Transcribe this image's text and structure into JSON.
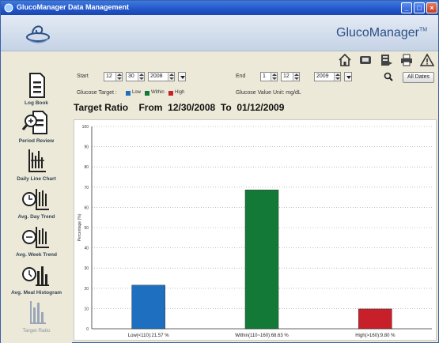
{
  "window": {
    "title": "GlucoManager Data Management"
  },
  "brand": {
    "name": "GlucoManager",
    "mark": "TM"
  },
  "tools": [
    {
      "icon": "home-icon"
    },
    {
      "icon": "device-icon"
    },
    {
      "icon": "export-icon"
    },
    {
      "icon": "print-icon"
    },
    {
      "icon": "warning-icon"
    }
  ],
  "sidebar": {
    "items": [
      {
        "label": "Log Book",
        "icon": "logbook-icon",
        "active": false
      },
      {
        "label": "Period Review",
        "icon": "period-review-icon",
        "active": false
      },
      {
        "label": "Daily Line Chart",
        "icon": "daily-line-chart-icon",
        "active": false
      },
      {
        "label": "Avg. Day Trend",
        "icon": "avg-day-trend-icon",
        "active": false
      },
      {
        "label": "Avg. Week Trend",
        "icon": "avg-week-trend-icon",
        "active": false
      },
      {
        "label": "Avg. Meal Histogram",
        "icon": "avg-meal-histogram-icon",
        "active": false
      },
      {
        "label": "Target Ratio",
        "icon": "target-ratio-icon",
        "active": true
      }
    ]
  },
  "filter": {
    "start_label": "Start",
    "start_month": "12",
    "start_day": "30",
    "start_year": "2008",
    "end_label": "End",
    "end_month": "1",
    "end_day": "12",
    "end_year": "2009",
    "all_dates_label": "All Dates",
    "glucose_target_label": "Glucose Target :",
    "legend": [
      {
        "label": "Low",
        "color": "#1f6fc0"
      },
      {
        "label": "Within",
        "color": "#127a36"
      },
      {
        "label": "High",
        "color": "#c8202a"
      }
    ],
    "unit_label": "Glucose Value Unit: mg/dL"
  },
  "heading": {
    "title": "Target Ratio",
    "from_label": "From",
    "from_date": "12/30/2008",
    "to_label": "To",
    "to_date": "01/12/2009"
  },
  "chart_data": {
    "type": "bar",
    "ylabel": "Percentage (%)",
    "ylim": [
      0,
      100
    ],
    "yticks": [
      0,
      10,
      20,
      30,
      40,
      50,
      60,
      70,
      80,
      90,
      100
    ],
    "grid": true,
    "categories": [
      "Low(<110):21.57 %",
      "Within(110~160):68.63 %",
      "High(>160):9.80 %"
    ],
    "values": [
      21.57,
      68.63,
      9.8
    ],
    "colors": [
      "#1f6fc0",
      "#127a36",
      "#c8202a"
    ]
  }
}
